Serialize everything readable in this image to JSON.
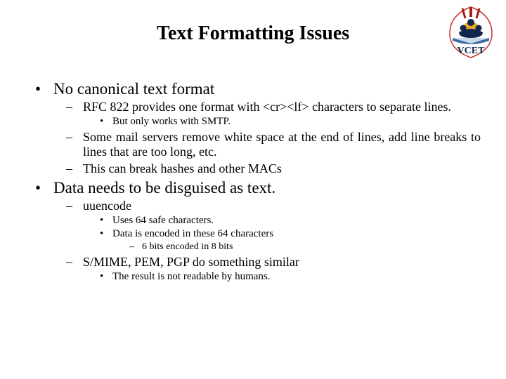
{
  "title": "Text Formatting Issues",
  "logo_label": "VCET",
  "b1": {
    "t": "No canonical text format",
    "s1": {
      "t": "RFC 822 provides one format with <cr><lf> characters to separate lines.",
      "s1": "But only works with SMTP."
    },
    "s2": "Some mail servers remove white space at the end of lines, add line breaks to lines that are too long, etc.",
    "s3": "This can break hashes and other MACs"
  },
  "b2": {
    "t": "Data needs to be disguised as text.",
    "s1": {
      "t": "uuencode",
      "s1": "Uses 64 safe characters.",
      "s2": "Data is encoded in these 64 characters",
      "s2s1": "6 bits encoded in 8 bits"
    },
    "s2": {
      "t": "S/MIME, PEM, PGP do something similar",
      "s1": "The result is not readable by humans."
    }
  }
}
